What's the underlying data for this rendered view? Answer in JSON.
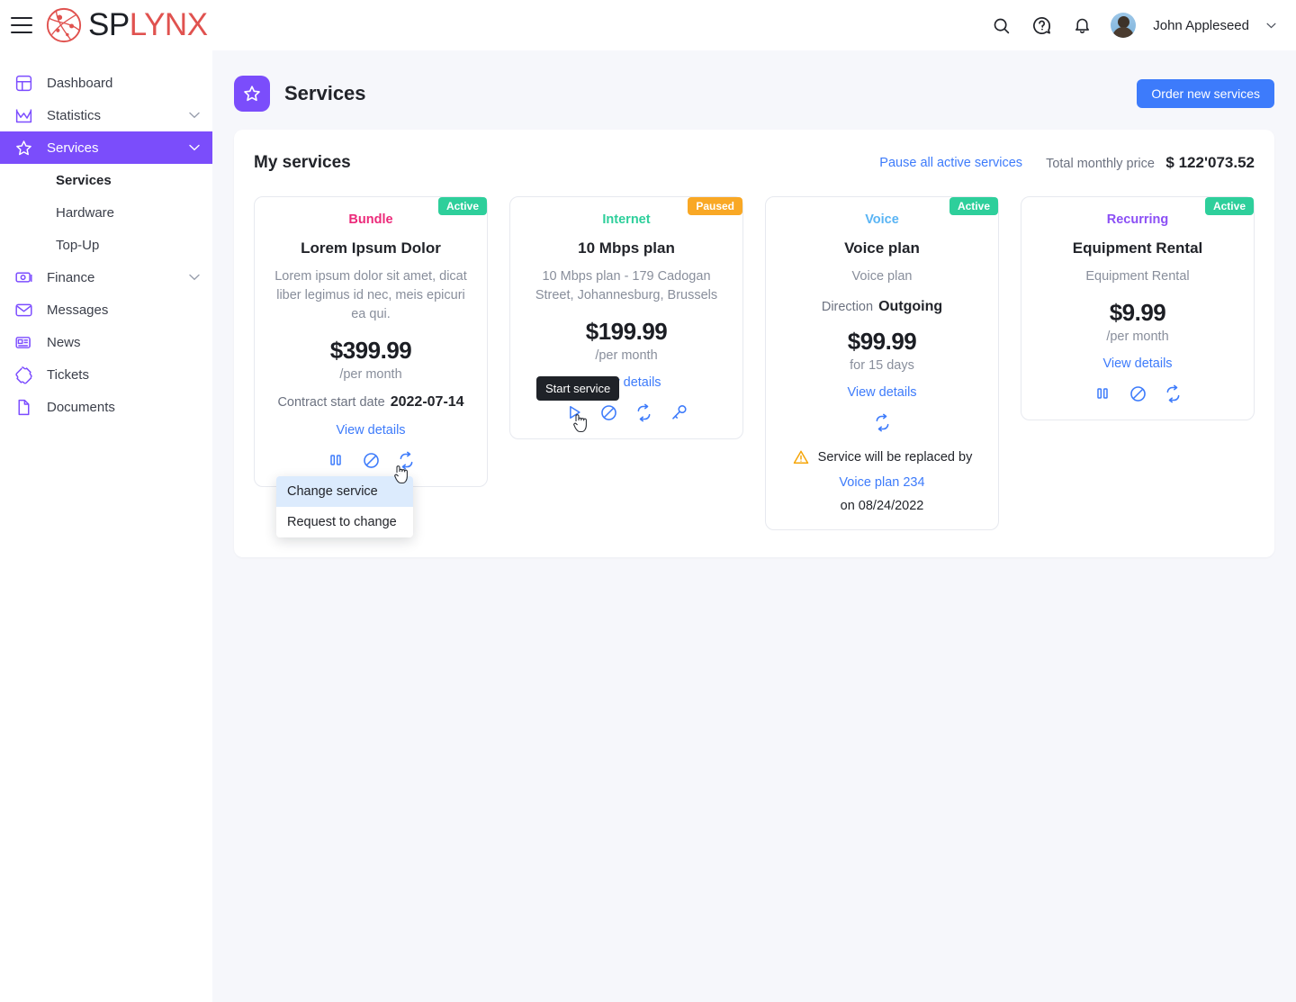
{
  "topbar": {
    "menu_icon": "hamburger-icon",
    "logo_sp": "SP",
    "logo_lynx": "LYNX",
    "search_icon": "search-icon",
    "help_icon": "help-circle-icon",
    "notifications_icon": "bell-icon",
    "username": "John Appleseed",
    "caret_icon": "chevron-down-icon"
  },
  "sidebar": {
    "items": [
      {
        "label": "Dashboard",
        "icon": "dashboard-icon",
        "expandable": false,
        "active": false
      },
      {
        "label": "Statistics",
        "icon": "statistics-icon",
        "expandable": true,
        "active": false
      },
      {
        "label": "Services",
        "icon": "star-icon",
        "expandable": true,
        "active": true
      }
    ],
    "sub_items": [
      {
        "label": "Services",
        "current": true
      },
      {
        "label": "Hardware",
        "current": false
      },
      {
        "label": "Top-Up",
        "current": false
      }
    ],
    "items_after": [
      {
        "label": "Finance",
        "icon": "money-icon",
        "expandable": true,
        "active": false
      },
      {
        "label": "Messages",
        "icon": "envelope-icon",
        "expandable": false,
        "active": false
      },
      {
        "label": "News",
        "icon": "news-icon",
        "expandable": false,
        "active": false
      },
      {
        "label": "Tickets",
        "icon": "ticket-icon",
        "expandable": false,
        "active": false
      },
      {
        "label": "Documents",
        "icon": "document-icon",
        "expandable": false,
        "active": false
      }
    ]
  },
  "page": {
    "icon": "star-icon",
    "title": "Services",
    "order_button": "Order new services"
  },
  "panel": {
    "title": "My services",
    "pause_all": "Pause all active services",
    "total_label": "Total monthly price",
    "total_value": "$ 122'073.52"
  },
  "cards": [
    {
      "type": "Bundle",
      "type_color": "#ec2a7a",
      "badge": "Active",
      "badge_color": "#2ecf9b",
      "name": "Lorem Ipsum Dolor",
      "desc": "Lorem ipsum dolor sit amet, dicat liber legimus id nec, meis epicuri ea qui.",
      "price": "$399.99",
      "period": "/per month",
      "kv_label": "Contract start date",
      "kv_value": "2022-07-14",
      "link": "View details",
      "actions": [
        "pause-icon",
        "block-icon",
        "change-icon"
      ]
    },
    {
      "type": "Internet",
      "type_color": "#2ecf9b",
      "badge": "Paused",
      "badge_color": "#f9a825",
      "name": "10 Mbps plan",
      "desc": "10 Mbps plan - 179 Cadogan Street, Johannesburg, Brussels",
      "price": "$199.99",
      "period": "/per month",
      "link": "View details",
      "actions": [
        "play-icon",
        "block-icon",
        "change-icon",
        "key-icon"
      ]
    },
    {
      "type": "Voice",
      "type_color": "#59b4f4",
      "badge": "Active",
      "badge_color": "#2ecf9b",
      "name": "Voice plan",
      "desc": "Voice plan",
      "kv_label": "Direction",
      "kv_value": "Outgoing",
      "price": "$99.99",
      "period": "for 15 days",
      "link": "View details",
      "actions": [
        "change-icon"
      ],
      "replace_text": "Service will be replaced by",
      "replace_link": "Voice plan 234",
      "replace_date": "on 08/24/2022",
      "warn_icon": "warning-triangle-icon"
    },
    {
      "type": "Recurring",
      "type_color": "#8b4ff5",
      "badge": "Active",
      "badge_color": "#2ecf9b",
      "name": "Equipment Rental",
      "desc": "Equipment Rental",
      "price": "$9.99",
      "period": "/per month",
      "link": "View details",
      "actions": [
        "pause-icon",
        "block-icon",
        "change-icon"
      ]
    }
  ],
  "tooltip": {
    "text": "Start service"
  },
  "dropdown": {
    "items": [
      {
        "label": "Change service",
        "selected": true
      },
      {
        "label": "Request to change",
        "selected": false
      }
    ]
  }
}
